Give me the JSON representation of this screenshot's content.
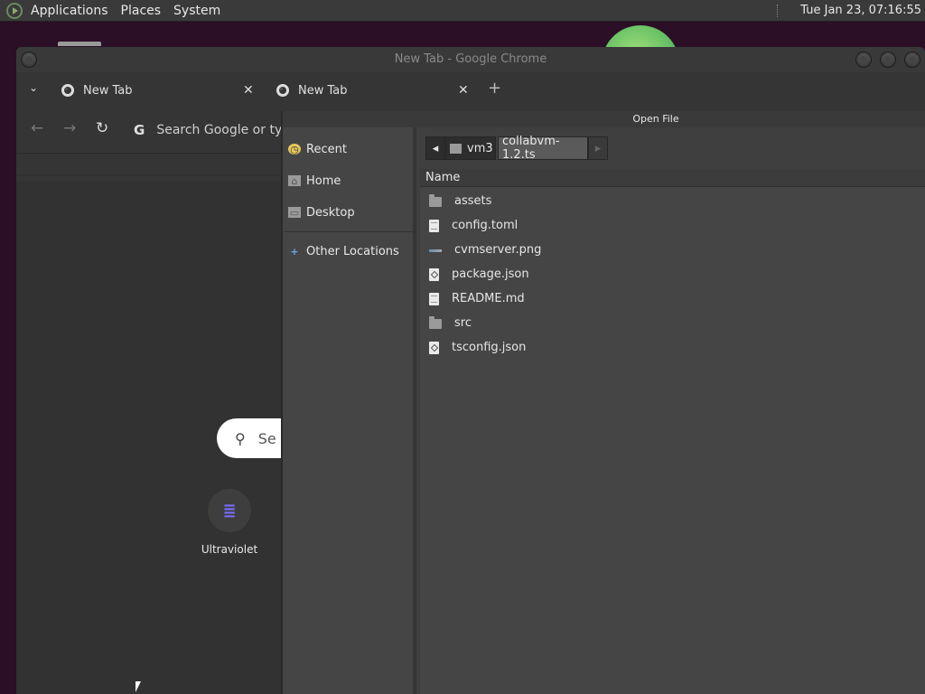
{
  "top_panel": {
    "menus": [
      "Applications",
      "Places",
      "System"
    ],
    "clock": "Tue Jan 23, 07:16:55"
  },
  "chrome": {
    "window_title": "New Tab - Google Chrome",
    "tabs": [
      {
        "label": "New Tab",
        "close": "✕"
      },
      {
        "label": "New Tab",
        "close": "✕"
      }
    ],
    "new_tab": "+",
    "omnibox_placeholder": "Search Google or type",
    "ntp_search_placeholder": "Se",
    "shortcut_label": "Ultraviolet"
  },
  "dialog": {
    "title": "Open File",
    "sidebar": [
      {
        "label": "Recent",
        "icon": "recent-icon"
      },
      {
        "label": "Home",
        "icon": "home-icon"
      },
      {
        "label": "Desktop",
        "icon": "desktop-icon"
      },
      {
        "label": "Other Locations",
        "icon": "plus-icon"
      }
    ],
    "path": [
      "vm3",
      "collabvm-1.2.ts"
    ],
    "column_header": "Name",
    "files": [
      {
        "name": "assets",
        "type": "folder"
      },
      {
        "name": "config.toml",
        "type": "document"
      },
      {
        "name": "cvmserver.png",
        "type": "image"
      },
      {
        "name": "package.json",
        "type": "code"
      },
      {
        "name": "README.md",
        "type": "document"
      },
      {
        "name": "src",
        "type": "folder"
      },
      {
        "name": "tsconfig.json",
        "type": "code"
      }
    ]
  }
}
